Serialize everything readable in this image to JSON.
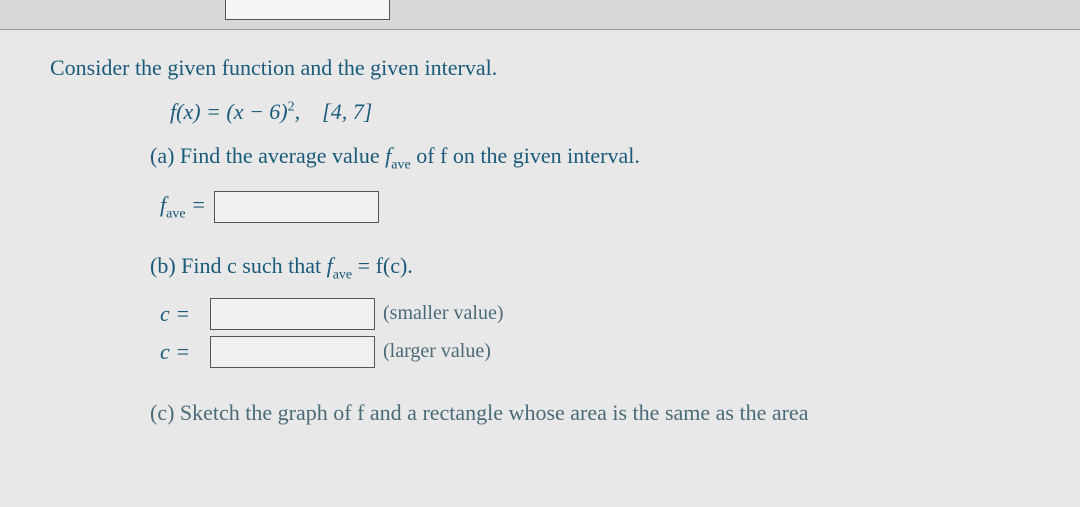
{
  "intro": "Consider the given function and the given interval.",
  "formula": {
    "fx": "f(x) = (x − 6)",
    "exp": "2",
    "interval": ", [4, 7]"
  },
  "partA": {
    "label": "(a) Find the average value ",
    "fave_f": "f",
    "fave_sub": "ave",
    "rest": " of f on the given interval."
  },
  "faveAnswer": {
    "f": "f",
    "sub": "ave",
    "eq": " ="
  },
  "partB": {
    "label": "(b) Find c such that ",
    "f": "f",
    "sub": "ave",
    "eq": " = f(c)."
  },
  "cRows": {
    "c1_label": "c =",
    "c1_hint": "(smaller value)",
    "c2_label": "c =",
    "c2_hint": "(larger value)"
  },
  "partC": {
    "text": "(c) Sketch the graph of f and a rectangle whose area is the same as the area"
  }
}
